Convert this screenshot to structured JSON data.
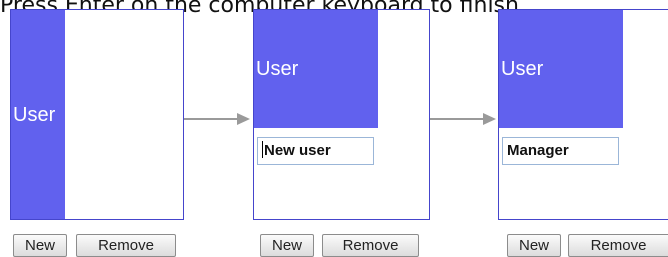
{
  "instruction": "Press Enter on the computer keyboard to finish",
  "buttons": {
    "new": "New",
    "remove": "Remove"
  },
  "colors": {
    "block": "#6161ee",
    "border": "#4545cc",
    "arrow": "#9a9a9a"
  },
  "steps": [
    {
      "block_label": "User"
    },
    {
      "block_label": "User",
      "input_value": "New user"
    },
    {
      "block_label": "User",
      "input_value": "Manager"
    }
  ]
}
